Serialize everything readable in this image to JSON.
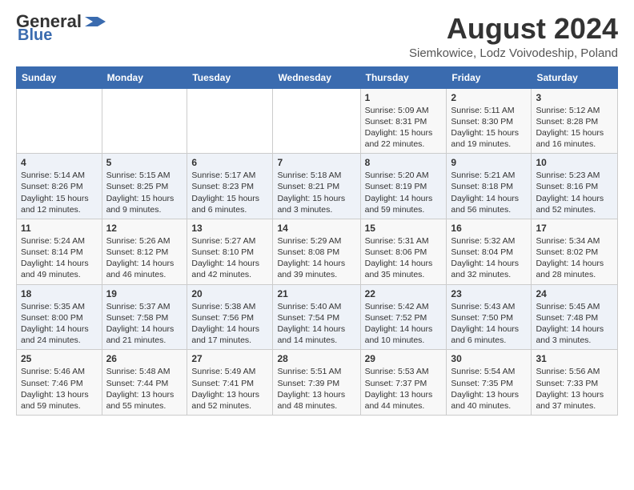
{
  "header": {
    "logo_general": "General",
    "logo_blue": "Blue",
    "month_title": "August 2024",
    "location": "Siemkowice, Lodz Voivodeship, Poland"
  },
  "weekdays": [
    "Sunday",
    "Monday",
    "Tuesday",
    "Wednesday",
    "Thursday",
    "Friday",
    "Saturday"
  ],
  "weeks": [
    [
      {
        "day": "",
        "content": ""
      },
      {
        "day": "",
        "content": ""
      },
      {
        "day": "",
        "content": ""
      },
      {
        "day": "",
        "content": ""
      },
      {
        "day": "1",
        "content": "Sunrise: 5:09 AM\nSunset: 8:31 PM\nDaylight: 15 hours\nand 22 minutes."
      },
      {
        "day": "2",
        "content": "Sunrise: 5:11 AM\nSunset: 8:30 PM\nDaylight: 15 hours\nand 19 minutes."
      },
      {
        "day": "3",
        "content": "Sunrise: 5:12 AM\nSunset: 8:28 PM\nDaylight: 15 hours\nand 16 minutes."
      }
    ],
    [
      {
        "day": "4",
        "content": "Sunrise: 5:14 AM\nSunset: 8:26 PM\nDaylight: 15 hours\nand 12 minutes."
      },
      {
        "day": "5",
        "content": "Sunrise: 5:15 AM\nSunset: 8:25 PM\nDaylight: 15 hours\nand 9 minutes."
      },
      {
        "day": "6",
        "content": "Sunrise: 5:17 AM\nSunset: 8:23 PM\nDaylight: 15 hours\nand 6 minutes."
      },
      {
        "day": "7",
        "content": "Sunrise: 5:18 AM\nSunset: 8:21 PM\nDaylight: 15 hours\nand 3 minutes."
      },
      {
        "day": "8",
        "content": "Sunrise: 5:20 AM\nSunset: 8:19 PM\nDaylight: 14 hours\nand 59 minutes."
      },
      {
        "day": "9",
        "content": "Sunrise: 5:21 AM\nSunset: 8:18 PM\nDaylight: 14 hours\nand 56 minutes."
      },
      {
        "day": "10",
        "content": "Sunrise: 5:23 AM\nSunset: 8:16 PM\nDaylight: 14 hours\nand 52 minutes."
      }
    ],
    [
      {
        "day": "11",
        "content": "Sunrise: 5:24 AM\nSunset: 8:14 PM\nDaylight: 14 hours\nand 49 minutes."
      },
      {
        "day": "12",
        "content": "Sunrise: 5:26 AM\nSunset: 8:12 PM\nDaylight: 14 hours\nand 46 minutes."
      },
      {
        "day": "13",
        "content": "Sunrise: 5:27 AM\nSunset: 8:10 PM\nDaylight: 14 hours\nand 42 minutes."
      },
      {
        "day": "14",
        "content": "Sunrise: 5:29 AM\nSunset: 8:08 PM\nDaylight: 14 hours\nand 39 minutes."
      },
      {
        "day": "15",
        "content": "Sunrise: 5:31 AM\nSunset: 8:06 PM\nDaylight: 14 hours\nand 35 minutes."
      },
      {
        "day": "16",
        "content": "Sunrise: 5:32 AM\nSunset: 8:04 PM\nDaylight: 14 hours\nand 32 minutes."
      },
      {
        "day": "17",
        "content": "Sunrise: 5:34 AM\nSunset: 8:02 PM\nDaylight: 14 hours\nand 28 minutes."
      }
    ],
    [
      {
        "day": "18",
        "content": "Sunrise: 5:35 AM\nSunset: 8:00 PM\nDaylight: 14 hours\nand 24 minutes."
      },
      {
        "day": "19",
        "content": "Sunrise: 5:37 AM\nSunset: 7:58 PM\nDaylight: 14 hours\nand 21 minutes."
      },
      {
        "day": "20",
        "content": "Sunrise: 5:38 AM\nSunset: 7:56 PM\nDaylight: 14 hours\nand 17 minutes."
      },
      {
        "day": "21",
        "content": "Sunrise: 5:40 AM\nSunset: 7:54 PM\nDaylight: 14 hours\nand 14 minutes."
      },
      {
        "day": "22",
        "content": "Sunrise: 5:42 AM\nSunset: 7:52 PM\nDaylight: 14 hours\nand 10 minutes."
      },
      {
        "day": "23",
        "content": "Sunrise: 5:43 AM\nSunset: 7:50 PM\nDaylight: 14 hours\nand 6 minutes."
      },
      {
        "day": "24",
        "content": "Sunrise: 5:45 AM\nSunset: 7:48 PM\nDaylight: 14 hours\nand 3 minutes."
      }
    ],
    [
      {
        "day": "25",
        "content": "Sunrise: 5:46 AM\nSunset: 7:46 PM\nDaylight: 13 hours\nand 59 minutes."
      },
      {
        "day": "26",
        "content": "Sunrise: 5:48 AM\nSunset: 7:44 PM\nDaylight: 13 hours\nand 55 minutes."
      },
      {
        "day": "27",
        "content": "Sunrise: 5:49 AM\nSunset: 7:41 PM\nDaylight: 13 hours\nand 52 minutes."
      },
      {
        "day": "28",
        "content": "Sunrise: 5:51 AM\nSunset: 7:39 PM\nDaylight: 13 hours\nand 48 minutes."
      },
      {
        "day": "29",
        "content": "Sunrise: 5:53 AM\nSunset: 7:37 PM\nDaylight: 13 hours\nand 44 minutes."
      },
      {
        "day": "30",
        "content": "Sunrise: 5:54 AM\nSunset: 7:35 PM\nDaylight: 13 hours\nand 40 minutes."
      },
      {
        "day": "31",
        "content": "Sunrise: 5:56 AM\nSunset: 7:33 PM\nDaylight: 13 hours\nand 37 minutes."
      }
    ]
  ]
}
